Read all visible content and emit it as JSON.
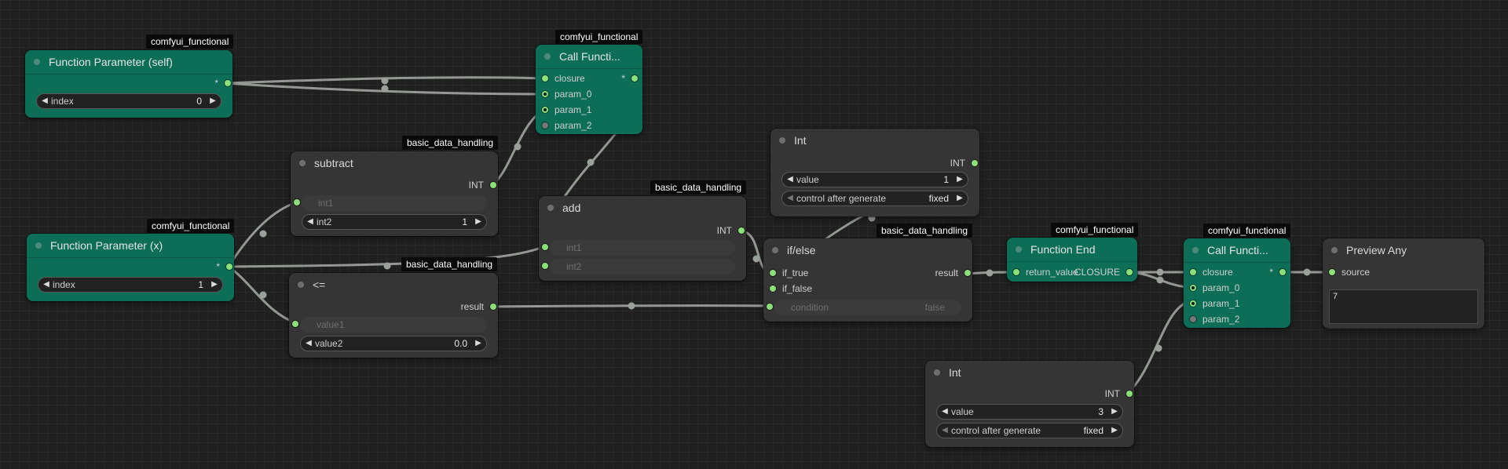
{
  "badges": {
    "comfyui_functional": "comfyui_functional",
    "basic_data_handling": "basic_data_handling"
  },
  "nodes": {
    "param_self": {
      "title": "Function Parameter (self)",
      "output": "*",
      "widget": {
        "label": "index",
        "value": "0"
      }
    },
    "param_x": {
      "title": "Function Parameter (x)",
      "output": "*",
      "widget": {
        "label": "index",
        "value": "1"
      }
    },
    "call_top": {
      "title": "Call Functi...",
      "inputs": [
        "closure",
        "param_0",
        "param_1",
        "param_2"
      ],
      "output": "*"
    },
    "subtract": {
      "title": "subtract",
      "output": "INT",
      "widget_disabled": "int1",
      "widget": {
        "label": "int2",
        "value": "1"
      }
    },
    "add": {
      "title": "add",
      "output": "INT",
      "widget_disabled_1": "int1",
      "widget_disabled_2": "int2"
    },
    "lte": {
      "title": "<=",
      "output": "result",
      "widget_disabled": "value1",
      "widget": {
        "label": "value2",
        "value": "0.0"
      }
    },
    "int_top": {
      "title": "Int",
      "output": "INT",
      "widget_value": {
        "label": "value",
        "value": "1"
      },
      "widget_control": {
        "label": "control after generate",
        "value": "fixed"
      }
    },
    "ifelse": {
      "title": "if/else",
      "inputs": [
        "if_true",
        "if_false"
      ],
      "output": "result",
      "widget_disabled": {
        "label": "condition",
        "value": "false"
      }
    },
    "func_end": {
      "title": "Function End",
      "input": "return_value",
      "output": "CLOSURE"
    },
    "call_right": {
      "title": "Call Functi...",
      "inputs": [
        "closure",
        "param_0",
        "param_1",
        "param_2"
      ],
      "output": "*"
    },
    "preview": {
      "title": "Preview Any",
      "input": "source",
      "text": "7"
    },
    "int_bottom": {
      "title": "Int",
      "output": "INT",
      "widget_value": {
        "label": "value",
        "value": "3"
      },
      "widget_control": {
        "label": "control after generate",
        "value": "fixed"
      }
    }
  },
  "colors": {
    "canvas": "#202020",
    "node": "#353535",
    "function_node": "#0c6e56",
    "port": "#8ce07a",
    "wire": "#9aa19a"
  }
}
